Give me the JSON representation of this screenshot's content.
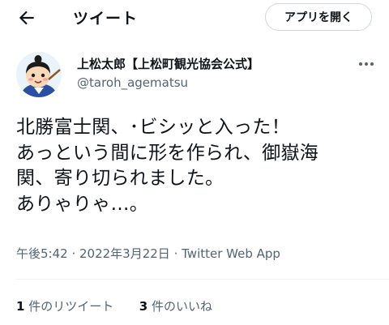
{
  "header": {
    "back_icon": "arrow-left-icon",
    "title": "ツイート",
    "open_app_label": "アプリを開く"
  },
  "author": {
    "display_name": "上松太郎【上松町観光協会公式】",
    "handle": "@taroh_agematsu",
    "more_icon": "more-horizontal-icon"
  },
  "tweet": {
    "text": "北勝富士関、･ビシッと入った！\nあっという間に形を作られ、御嶽海\n関、寄り切られました。\nありゃりゃ…。"
  },
  "meta": {
    "time": "午後5:42",
    "separator": " · ",
    "date": "2022年3月22日",
    "client": "Twitter Web App"
  },
  "stats": {
    "retweets_count": "1",
    "retweets_label": "件のリツイート",
    "likes_count": "3",
    "likes_label": "件のいいね"
  }
}
